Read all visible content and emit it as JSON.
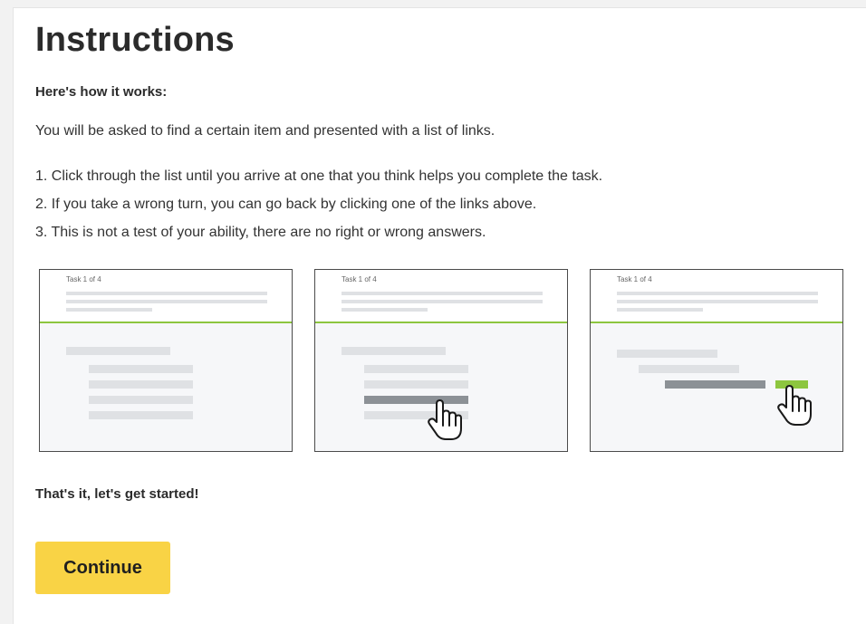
{
  "title": "Instructions",
  "subhead": "Here's how it works:",
  "intro": "You will be asked to find a certain item and presented with a list of links.",
  "steps": [
    "1. Click through the list until you arrive at one that you think helps you complete the task.",
    "2. If you take a wrong turn, you can go back by clicking one of the links above.",
    "3. This is not a test of your ability, there are no right or wrong answers."
  ],
  "illustrations": [
    {
      "task_label": "Task 1 of 4"
    },
    {
      "task_label": "Task 1 of 4"
    },
    {
      "task_label": "Task 1 of 4"
    }
  ],
  "closing": "That's it, let's get started!",
  "continue_label": "Continue",
  "colors": {
    "accent_green": "#8dc63f",
    "button_yellow": "#f9d345",
    "selected_bar": "#8c9196"
  },
  "icons": {
    "pointer": "hand-pointer-icon"
  }
}
